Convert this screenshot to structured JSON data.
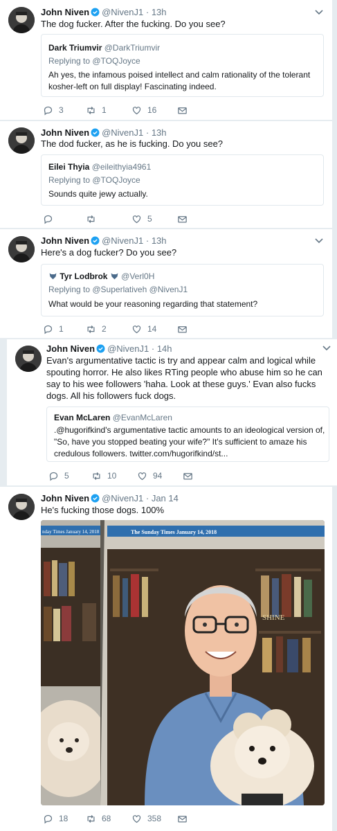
{
  "colors": {
    "text": "#14171a",
    "muted": "#657786",
    "border": "#e1e8ed",
    "verified": "#1da1f2",
    "bg": "#e6ecf0"
  },
  "tweets": [
    {
      "name": "John Niven",
      "handle": "@NivenJ1",
      "time": "· 13h",
      "text": "The dog fucker. After the fucking. Do you see?",
      "quote": {
        "name": "Dark Triumvir",
        "handle": "@DarkTriumvir",
        "replying_prefix": "Replying to ",
        "replying_to": "@TOQJoyce",
        "text": "Ah yes, the infamous poised intellect and calm rationality of the tolerant kosher-left on full display! Fascinating indeed."
      },
      "replies": "3",
      "retweets": "1",
      "likes": "16"
    },
    {
      "name": "John Niven",
      "handle": "@NivenJ1",
      "time": "· 13h",
      "text": "The dod fucker, as he is fucking. Do you see?",
      "quote": {
        "name": "Eilei Thyia",
        "handle": "@eileithyia4961",
        "replying_prefix": "Replying to ",
        "replying_to": "@TOQJoyce",
        "text": "Sounds quite jewy actually."
      },
      "replies": "",
      "retweets": "",
      "likes": "5"
    },
    {
      "name": "John Niven",
      "handle": "@NivenJ1",
      "time": "· 13h",
      "text": "Here's a dog fucker? Do you see?",
      "quote": {
        "name": "Tyr Lodbrok",
        "handle": "@Verl0H",
        "replying_prefix": "Replying to ",
        "replying_to": "@Superlativeh @NivenJ1",
        "text": "What would be your reasoning regarding that statement?"
      },
      "replies": "1",
      "retweets": "2",
      "likes": "14"
    },
    {
      "name": "John Niven",
      "handle": "@NivenJ1",
      "time": "· 14h",
      "text": "Evan's argumentative tactic is try and appear calm and logical while spouting horror. He also likes RTing people who abuse him so he can say to his wee followers 'haha. Look at these guys.' Evan also fucks dogs. All his followers fuck dogs.",
      "quote": {
        "name": "Evan McLaren",
        "handle": "@EvanMcLaren",
        "text": ".@hugorifkind's argumentative tactic amounts to an ideological version of, \"So, have you stopped beating your wife?\" It's sufficient to amaze his credulous followers. twitter.com/hugorifkind/st..."
      },
      "replies": "5",
      "retweets": "10",
      "likes": "94"
    },
    {
      "name": "John Niven",
      "handle": "@NivenJ1",
      "time": "· Jan 14",
      "text": "He's fucking those dogs. 100%",
      "photo": {
        "masthead_left": "nday Times January 14, 2018",
        "masthead_right": "The Sunday Times January 14, 2018",
        "shelf_text": "SHINE"
      },
      "replies": "18",
      "retweets": "68",
      "likes": "358"
    }
  ]
}
